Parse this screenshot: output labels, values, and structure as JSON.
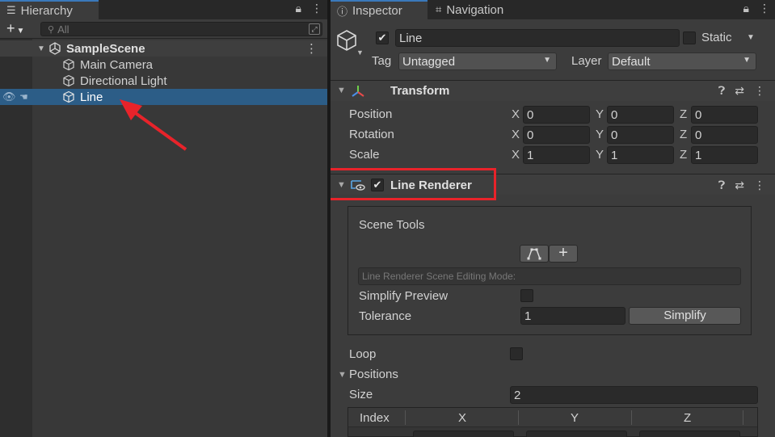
{
  "hierarchy": {
    "tab_label": "Hierarchy",
    "search_placeholder": "All",
    "add_label": "+",
    "scene_name": "SampleScene",
    "items": [
      {
        "label": "Main Camera"
      },
      {
        "label": "Directional Light"
      },
      {
        "label": "Line"
      }
    ]
  },
  "inspector": {
    "tabs": [
      {
        "label": "Inspector"
      },
      {
        "label": "Navigation"
      }
    ],
    "object": {
      "name": "Line",
      "static_label": "Static",
      "tag_label": "Tag",
      "tag_value": "Untagged",
      "layer_label": "Layer",
      "layer_value": "Default"
    },
    "transform": {
      "title": "Transform",
      "rows": [
        {
          "label": "Position",
          "x": "0",
          "y": "0",
          "z": "0"
        },
        {
          "label": "Rotation",
          "x": "0",
          "y": "0",
          "z": "0"
        },
        {
          "label": "Scale",
          "x": "1",
          "y": "1",
          "z": "1"
        }
      ],
      "axis_x": "X",
      "axis_y": "Y",
      "axis_z": "Z"
    },
    "line_renderer": {
      "title": "Line Renderer",
      "scene_tools_label": "Scene Tools",
      "editing_mode_label": "Line Renderer Scene Editing Mode:",
      "simplify_preview_label": "Simplify Preview",
      "tolerance_label": "Tolerance",
      "tolerance_value": "1",
      "simplify_button": "Simplify",
      "loop_label": "Loop",
      "positions_label": "Positions",
      "size_label": "Size",
      "size_value": "2",
      "table_headers": [
        "Index",
        "X",
        "Y",
        "Z"
      ]
    }
  },
  "colors": {
    "selection": "#2c5d87",
    "highlight": "#e8232a",
    "tab_accent": "#3a79bb"
  }
}
